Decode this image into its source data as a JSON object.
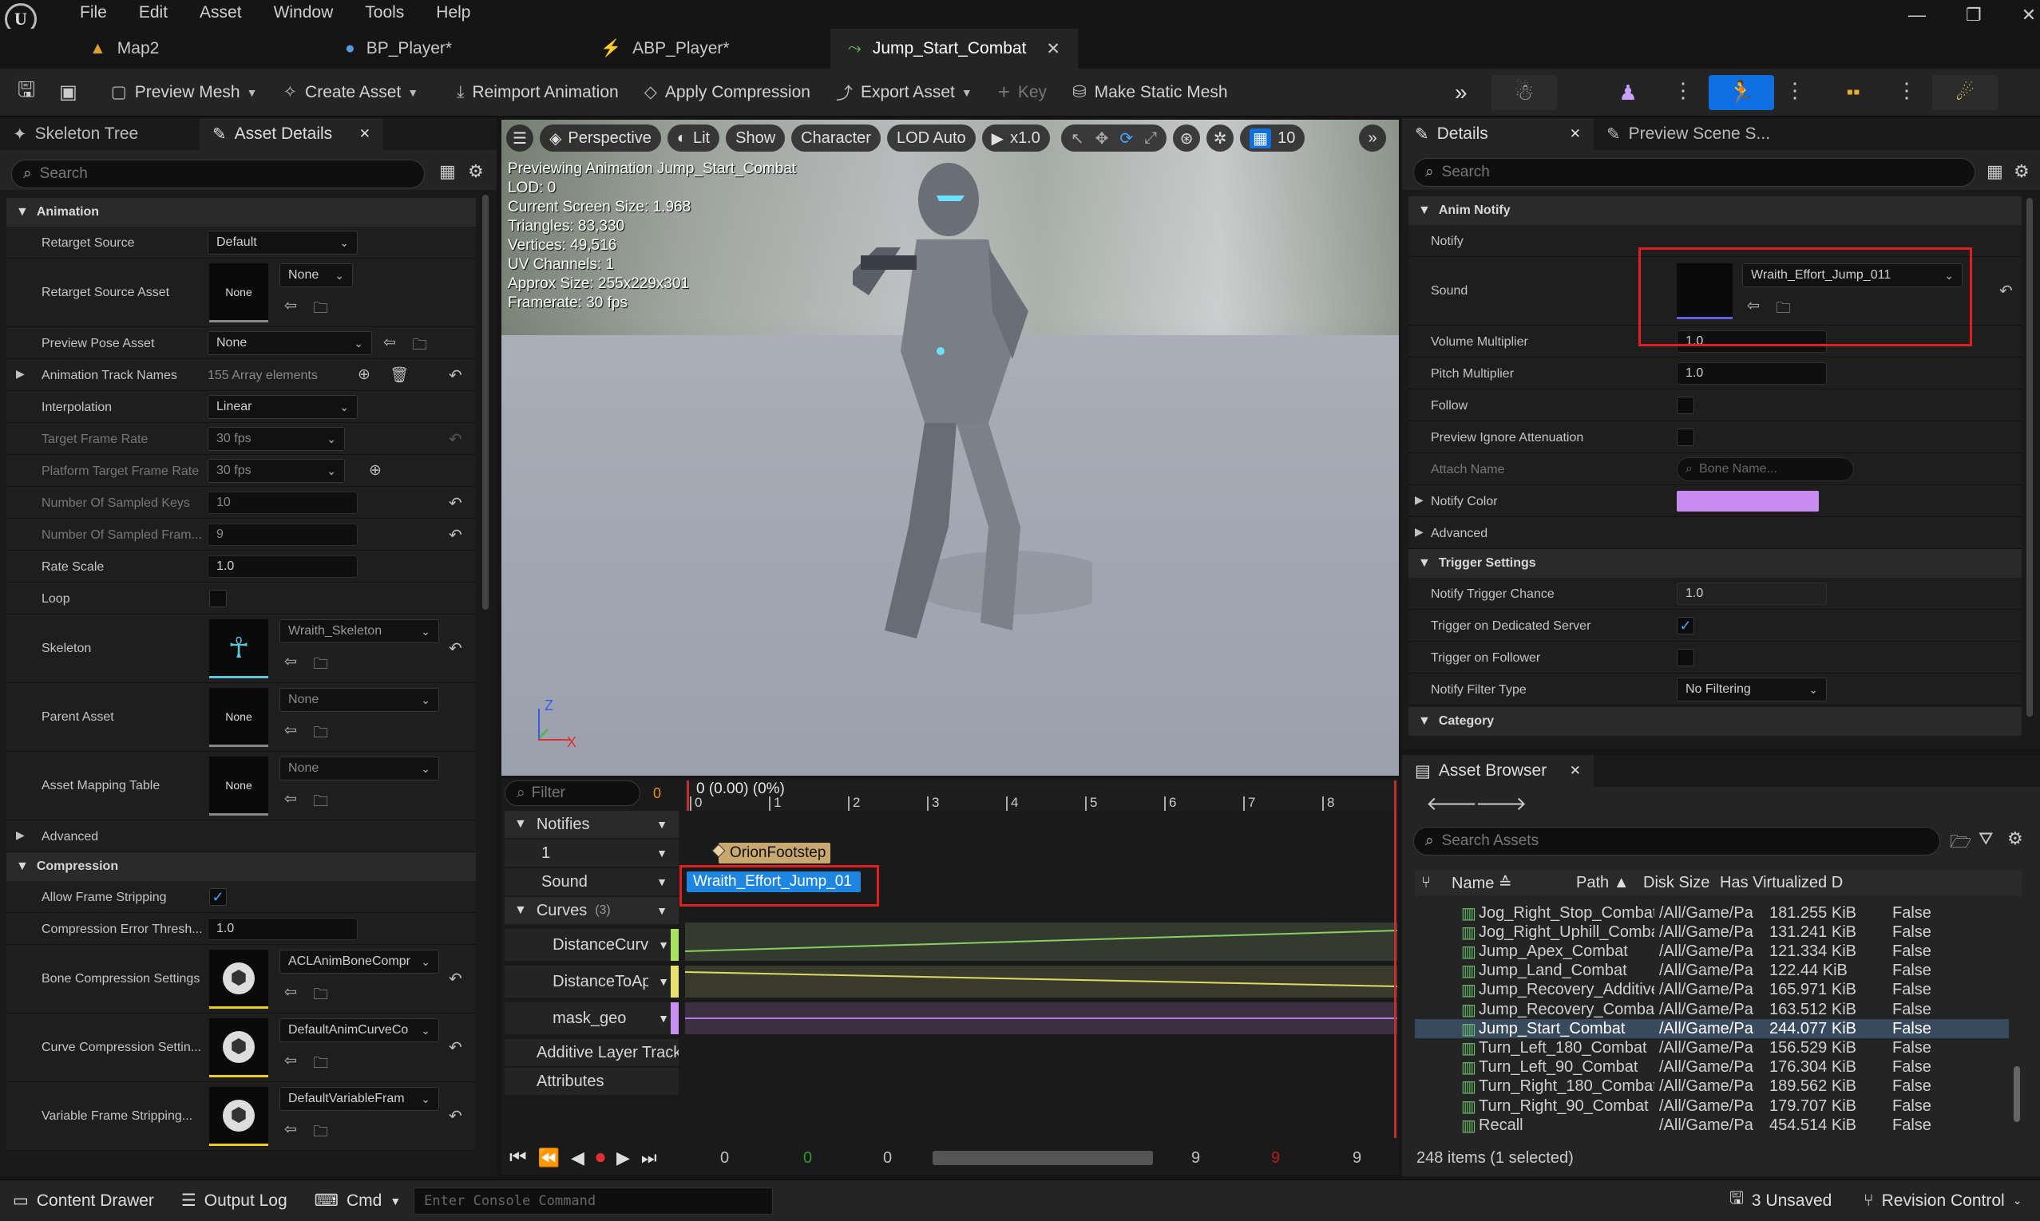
{
  "menu": [
    "File",
    "Edit",
    "Asset",
    "Window",
    "Tools",
    "Help"
  ],
  "tabs": [
    {
      "label": "Map2",
      "icon": "map-icon"
    },
    {
      "label": "BP_Player*",
      "icon": "blueprint-icon"
    },
    {
      "label": "ABP_Player*",
      "icon": "anim-blueprint-icon"
    },
    {
      "label": "Jump_Start_Combat",
      "icon": "animation-icon"
    }
  ],
  "toolbar": {
    "preview_mesh": "Preview Mesh",
    "create_asset": "Create Asset",
    "reimport": "Reimport Animation",
    "apply_compression": "Apply Compression",
    "export_asset": "Export Asset",
    "key": "Key",
    "make_static_mesh": "Make Static Mesh"
  },
  "left": {
    "tab_skeleton": "Skeleton Tree",
    "tab_asset_details": "Asset Details",
    "search": "Search",
    "animation_header": "Animation",
    "retarget_source": {
      "label": "Retarget Source",
      "value": "Default"
    },
    "retarget_source_asset": {
      "label": "Retarget Source Asset",
      "thumb": "None",
      "value": "None"
    },
    "preview_pose": {
      "label": "Preview Pose Asset",
      "value": "None"
    },
    "track_names": {
      "label": "Animation Track Names",
      "value": "155 Array elements"
    },
    "interpolation": {
      "label": "Interpolation",
      "value": "Linear"
    },
    "target_frame_rate": {
      "label": "Target Frame Rate",
      "value": "30 fps"
    },
    "platform_frame_rate": {
      "label": "Platform Target Frame Rate",
      "value": "30 fps"
    },
    "sampled_keys": {
      "label": "Number Of Sampled Keys",
      "value": "10"
    },
    "sampled_frames": {
      "label": "Number Of Sampled Fram...",
      "value": "9"
    },
    "rate_scale": {
      "label": "Rate Scale",
      "value": "1.0"
    },
    "loop": {
      "label": "Loop"
    },
    "skeleton": {
      "label": "Skeleton",
      "value": "Wraith_Skeleton"
    },
    "parent_asset": {
      "label": "Parent Asset",
      "thumb": "None",
      "value": "None"
    },
    "mapping_table": {
      "label": "Asset Mapping Table",
      "thumb": "None",
      "value": "None"
    },
    "advanced": "Advanced",
    "compression_header": "Compression",
    "allow_frame_stripping": {
      "label": "Allow Frame Stripping"
    },
    "compression_error": {
      "label": "Compression Error Thresh...",
      "value": "1.0"
    },
    "bone_compression": {
      "label": "Bone Compression Settings",
      "value": "ACLAnimBoneCompr"
    },
    "curve_compression": {
      "label": "Curve Compression Settin...",
      "value": "DefaultAnimCurveCo"
    },
    "variable_frame": {
      "label": "Variable Frame Stripping...",
      "value": "DefaultVariableFram"
    }
  },
  "viewport": {
    "perspective": "Perspective",
    "lit": "Lit",
    "show": "Show",
    "character": "Character",
    "lod": "LOD Auto",
    "speed": "x1.0",
    "grid": "10",
    "stats": [
      "Previewing Animation Jump_Start_Combat",
      "LOD: 0",
      "Current Screen Size: 1.968",
      "Triangles: 83,330",
      "Vertices: 49,516",
      "UV Channels: 1",
      "Approx Size: 255x229x301",
      "Framerate: 30 fps"
    ],
    "axis_z": "Z",
    "axis_x": "X"
  },
  "timeline": {
    "filter": "Filter",
    "filter_count": "0",
    "time": "0 (0.00) (0%)",
    "ruler": [
      "0",
      "1",
      "2",
      "3",
      "4",
      "5",
      "6",
      "7",
      "8"
    ],
    "notifies": "Notifies",
    "track1": "1",
    "sound": "Sound",
    "curves": "Curves",
    "curves_count": "(3)",
    "curve1": "DistanceCurv",
    "curve2": "DistanceToAp",
    "curve3": "mask_geo",
    "additive": "Additive Layer Track",
    "attributes": "Attributes",
    "notify_footstep": "OrionFootstep",
    "notify_sound": "Wraith_Effort_Jump_01",
    "frame_start": "0",
    "frame_green": "0",
    "frame_cur": "0",
    "frame_end": "9",
    "frame_red": "9",
    "frame_last": "9"
  },
  "details": {
    "tab_details": "Details",
    "tab_preview": "Preview Scene S...",
    "search": "Search",
    "anim_notify": "Anim Notify",
    "notify": "Notify",
    "sound": {
      "label": "Sound",
      "value": "Wraith_Effort_Jump_011"
    },
    "volume": {
      "label": "Volume Multiplier",
      "value": "1.0"
    },
    "pitch": {
      "label": "Pitch Multiplier",
      "value": "1.0"
    },
    "follow": "Follow",
    "preview_ignore": "Preview Ignore Attenuation",
    "attach": {
      "label": "Attach Name",
      "placeholder": "Bone Name..."
    },
    "notify_color": {
      "label": "Notify Color",
      "color": "#c88cf0"
    },
    "advanced": "Advanced",
    "trigger_settings": "Trigger Settings",
    "trigger_chance": {
      "label": "Notify Trigger Chance",
      "value": "1.0"
    },
    "dedicated": "Trigger on Dedicated Server",
    "follower": "Trigger on Follower",
    "filter_type": {
      "label": "Notify Filter Type",
      "value": "No Filtering"
    },
    "category": "Category"
  },
  "asset_browser": {
    "tab": "Asset Browser",
    "search": "Search Assets",
    "columns": [
      "Name",
      "Path",
      "Disk Size",
      "Has Virtualized D"
    ],
    "rows": [
      [
        "Jog_Right_Stop_Combat",
        "/All/Game/Pa",
        "181.255 KiB",
        "False"
      ],
      [
        "Jog_Right_Uphill_Comba",
        "/All/Game/Pa",
        "131.241 KiB",
        "False"
      ],
      [
        "Jump_Apex_Combat",
        "/All/Game/Pa",
        "121.334 KiB",
        "False"
      ],
      [
        "Jump_Land_Combat",
        "/All/Game/Pa",
        "122.44 KiB",
        "False"
      ],
      [
        "Jump_Recovery_Additive",
        "/All/Game/Pa",
        "165.971 KiB",
        "False"
      ],
      [
        "Jump_Recovery_Combat",
        "/All/Game/Pa",
        "163.512 KiB",
        "False"
      ],
      [
        "Jump_Start_Combat",
        "/All/Game/Pa",
        "244.077 KiB",
        "False"
      ],
      [
        "Turn_Left_180_Combat",
        "/All/Game/Pa",
        "156.529 KiB",
        "False"
      ],
      [
        "Turn_Left_90_Combat",
        "/All/Game/Pa",
        "176.304 KiB",
        "False"
      ],
      [
        "Turn_Right_180_Combat",
        "/All/Game/Pa",
        "189.562 KiB",
        "False"
      ],
      [
        "Turn_Right_90_Combat",
        "/All/Game/Pa",
        "179.707 KiB",
        "False"
      ],
      [
        "Recall",
        "/All/Game/Pa",
        "454.514 KiB",
        "False"
      ]
    ],
    "selected_index": 6,
    "count": "248 items (1 selected)"
  },
  "status": {
    "content_drawer": "Content Drawer",
    "output_log": "Output Log",
    "cmd": "Cmd",
    "console_placeholder": "Enter Console Command",
    "unsaved": "3 Unsaved",
    "revision": "Revision Control"
  }
}
